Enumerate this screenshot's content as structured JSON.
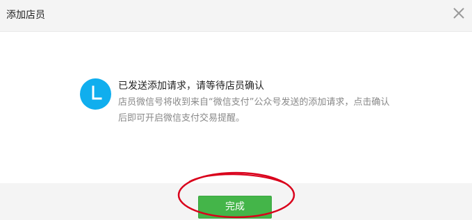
{
  "dialog": {
    "title": "添加店员",
    "close_icon": "close-icon"
  },
  "message": {
    "icon": "clock-icon",
    "icon_color": "#10aeee",
    "title": "已发送添加请求，请等待店员确认",
    "description": "店员微信号将收到来自“微信支付”公众号发送的添加请求，点击确认后即可开启微信支付交易提醒。"
  },
  "footer": {
    "done_label": "完成",
    "done_color": "#44b549"
  },
  "annotation": {
    "shape": "circle",
    "color": "#d9001b"
  }
}
